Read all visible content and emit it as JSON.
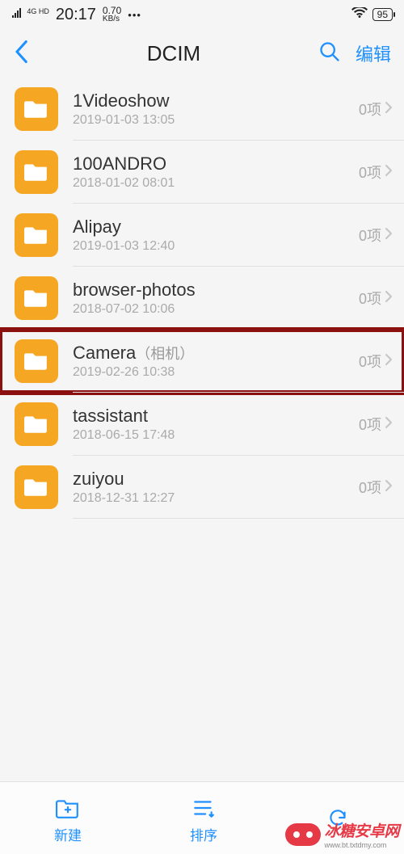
{
  "status": {
    "signal_label": "4G HD",
    "time": "20:17",
    "speed_num": "0.70",
    "speed_unit": "KB/s",
    "dots": "•••",
    "battery": "95"
  },
  "nav": {
    "title": "DCIM",
    "edit_label": "编辑"
  },
  "folders": [
    {
      "name": "1Videoshow",
      "alias": "",
      "date": "2019-01-03 13:05",
      "count": "0项",
      "highlight": false
    },
    {
      "name": "100ANDRO",
      "alias": "",
      "date": "2018-01-02 08:01",
      "count": "0项",
      "highlight": false
    },
    {
      "name": "Alipay",
      "alias": "",
      "date": "2019-01-03 12:40",
      "count": "0项",
      "highlight": false
    },
    {
      "name": "browser-photos",
      "alias": "",
      "date": "2018-07-02 10:06",
      "count": "0项",
      "highlight": false
    },
    {
      "name": "Camera",
      "alias": "（相机）",
      "date": "2019-02-26 10:38",
      "count": "0项",
      "highlight": true
    },
    {
      "name": "tassistant",
      "alias": "",
      "date": "2018-06-15 17:48",
      "count": "0项",
      "highlight": false
    },
    {
      "name": "zuiyou",
      "alias": "",
      "date": "2018-12-31 12:27",
      "count": "0项",
      "highlight": false
    }
  ],
  "bottom": {
    "new_label": "新建",
    "sort_label": "排序",
    "refresh_label": ""
  },
  "watermark": {
    "text": "冰糖安卓网",
    "url": "www.bt.txtdmy.com"
  }
}
